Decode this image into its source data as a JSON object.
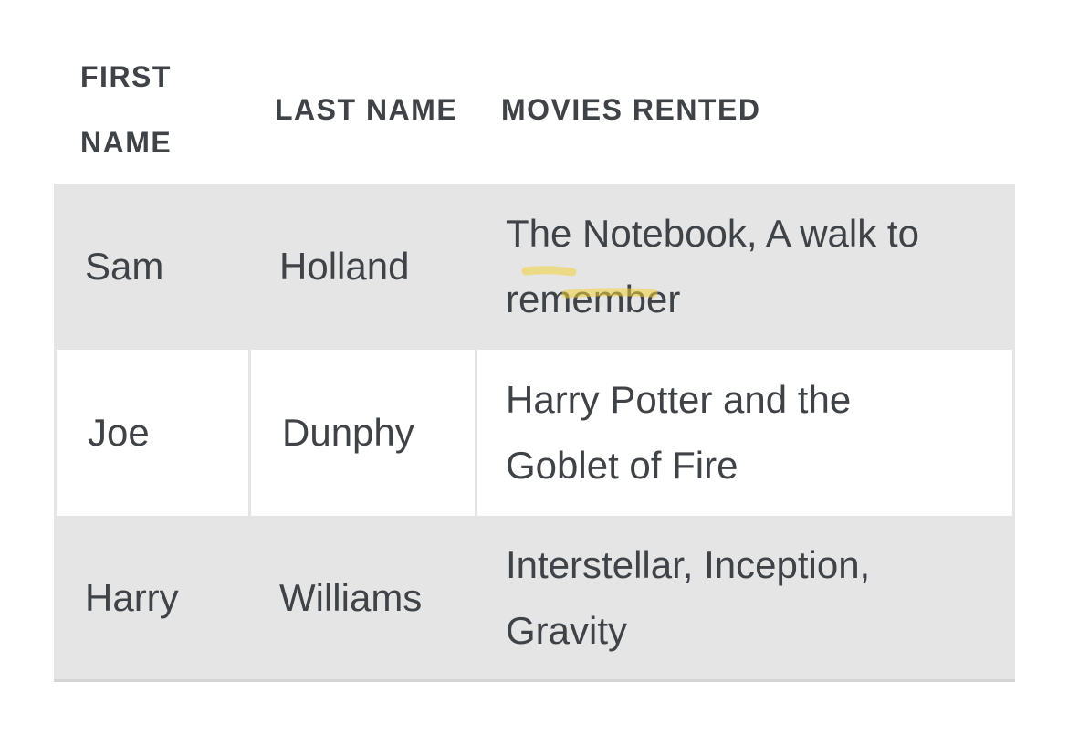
{
  "table": {
    "headers": {
      "first_name": "FIRST NAME",
      "last_name": "LAST NAME",
      "movies_rented": "MOVIES RENTED"
    },
    "rows": [
      {
        "first_name": "Sam",
        "last_name": "Holland",
        "movies": "The Notebook, A walk to remember"
      },
      {
        "first_name": "Joe",
        "last_name": "Dunphy",
        "movies": "Harry Potter and the Goblet of Fire"
      },
      {
        "first_name": "Harry",
        "last_name": "Williams",
        "movies": "Interstellar, Inception, Gravity"
      }
    ]
  },
  "colors": {
    "text": "#3f4246",
    "stripe": "#e5e5e5",
    "highlight": "#f2d23a"
  }
}
